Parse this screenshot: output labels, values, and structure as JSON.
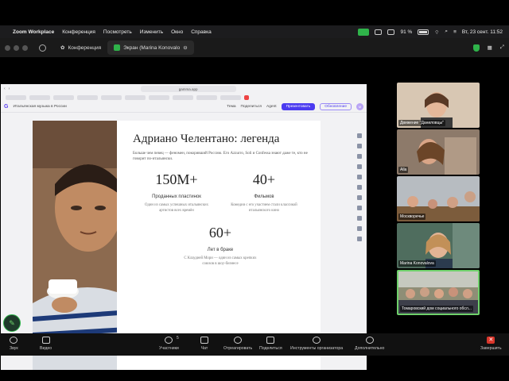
{
  "menubar": {
    "app": "Zoom Workplace",
    "items": [
      "Конференция",
      "Посмотреть",
      "Изменить",
      "Окно",
      "Справка"
    ],
    "battery": "91 %",
    "datetime": "Вт, 23 сент.  11:52"
  },
  "zoombar": {
    "tab1": "Конференция",
    "tab2": "Экран (Marina Konovalo"
  },
  "browser": {
    "url": "gamma.app",
    "doc_title": "Итальянская музыка в России",
    "tools": [
      "Тема",
      "Поделиться",
      "Agent"
    ],
    "present": "Презентовать",
    "share": "Обновление",
    "avatar": "M"
  },
  "slide": {
    "title": "Адриано Челентано: легенда",
    "intro": "Больше чем певец — феномен, покоривший Россию. Его Azzurro, Soli и Confessa знают даже те, кто не говорит по-итальянски.",
    "stats": [
      {
        "num": "150M+",
        "label": "Проданных пластинок",
        "desc": "Один из самых успешных итальянских артистов всех времён"
      },
      {
        "num": "40+",
        "label": "Фильмов",
        "desc": "Комедии с его участием стали классикой итальянского кино"
      },
      {
        "num": "60+",
        "label": "Лет в браке",
        "desc": "С Клаудией Мори — один из самых крепких союзов в шоу-бизнесе"
      }
    ]
  },
  "tiles": [
    {
      "name": "Движение \"Даниловцы\"",
      "color": "#c9a88c"
    },
    {
      "name": "Alla",
      "color": "#8d7562"
    },
    {
      "name": "Москворечье",
      "color": "#9ca2a6"
    },
    {
      "name": "Marina Konovalova",
      "color": "#6f8a7e"
    },
    {
      "name": "Томаровский дом социального обсл...",
      "color": "#8b8a73"
    }
  ],
  "toolbar": {
    "audio": "Звук",
    "video": "Видео",
    "participants": "Участники",
    "participants_count": "5",
    "chat": "Чат",
    "react": "Отреагировать",
    "share": "Поделиться",
    "host_tools": "Инструменты организатора",
    "more": "Дополнительно",
    "end": "Завершить"
  }
}
